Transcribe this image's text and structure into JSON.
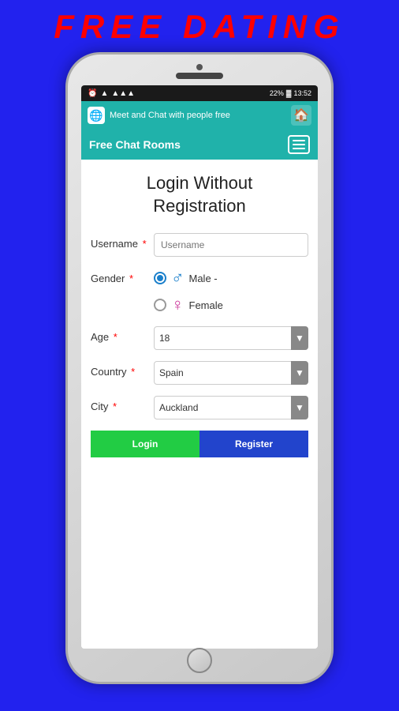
{
  "page": {
    "title": "FREE  DATING",
    "background_color": "#2222ee"
  },
  "phone": {
    "status_bar": {
      "time": "13:52",
      "battery": "22%",
      "signal": "▲▲▲",
      "wifi": "▲",
      "alarm": "⏰"
    },
    "browser_bar": {
      "title": "Meet and Chat with people free",
      "home_icon": "🏠"
    },
    "nav_bar": {
      "title": "Free Chat Rooms"
    },
    "form": {
      "page_title_line1": "Login Without",
      "page_title_line2": "Registration",
      "username_label": "Username",
      "username_placeholder": "Username",
      "gender_label": "Gender",
      "gender_male_label": "Male -",
      "gender_female_label": "Female",
      "age_label": "Age",
      "age_value": "18",
      "country_label": "Country",
      "country_value": "Spain",
      "city_label": "City",
      "city_value": "Auckland"
    }
  }
}
